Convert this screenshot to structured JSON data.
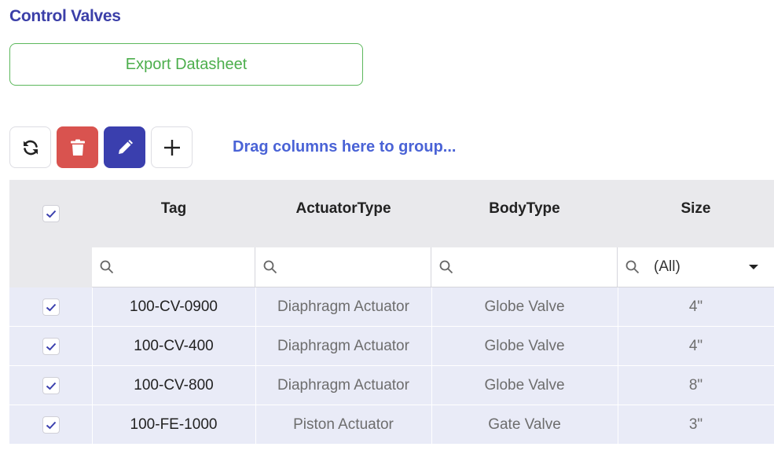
{
  "page": {
    "title": "Control Valves"
  },
  "export": {
    "label": "Export Datasheet"
  },
  "toolbar": {
    "refresh_icon": "refresh-icon",
    "delete_icon": "trash-icon",
    "edit_icon": "pencil-icon",
    "add_icon": "plus-icon",
    "group_hint": "Drag columns here to group..."
  },
  "colors": {
    "title": "#3b3fa8",
    "export_border": "#5cb85c",
    "delete_bg": "#d9534f",
    "edit_bg": "#3a3fae",
    "group_hint": "#4a63d6",
    "header_bg": "#e9e9ec",
    "row_bg": "#e9ebf7"
  },
  "grid": {
    "columns": [
      "Tag",
      "ActuatorType",
      "BodyType",
      "Size"
    ],
    "size_filter": "(All)",
    "rows": [
      {
        "checked": true,
        "tag": "100-CV-0900",
        "actuator": "Diaphragm Actuator",
        "body": "Globe Valve",
        "size": "4\""
      },
      {
        "checked": true,
        "tag": "100-CV-400",
        "actuator": "Diaphragm Actuator",
        "body": "Globe Valve",
        "size": "4\""
      },
      {
        "checked": true,
        "tag": "100-CV-800",
        "actuator": "Diaphragm Actuator",
        "body": "Globe Valve",
        "size": "8\""
      },
      {
        "checked": true,
        "tag": "100-FE-1000",
        "actuator": "Piston Actuator",
        "body": "Gate Valve",
        "size": "3\""
      }
    ]
  }
}
